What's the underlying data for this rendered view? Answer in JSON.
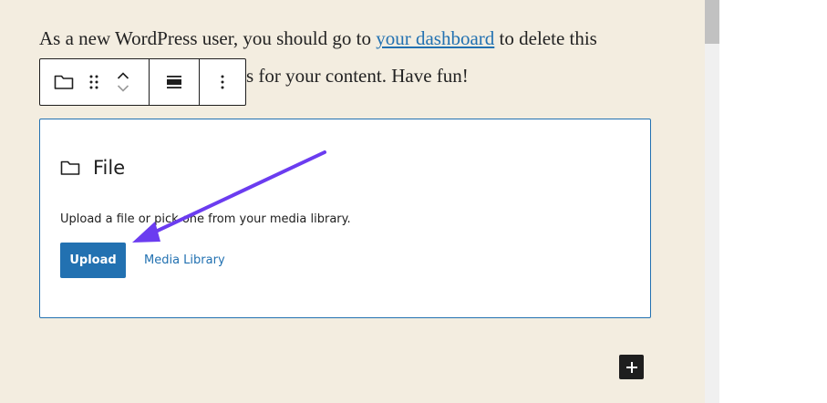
{
  "paragraph": {
    "before": "As a new WordPress user, you should go to ",
    "link": "your dashboard",
    "after": " to delete this",
    "line2": "s for your content. Have fun!"
  },
  "toolbar": {
    "icons": [
      "folder-icon",
      "drag-handle-icon",
      "move-up-icon",
      "move-down-icon",
      "align-icon",
      "more-options-icon"
    ]
  },
  "file_block": {
    "title": "File",
    "instructions": "Upload a file or pick one from your media library.",
    "upload_label": "Upload",
    "media_library_label": "Media Library"
  },
  "colors": {
    "accent": "#2271b1",
    "canvas": "#f3ede0",
    "annotation_arrow": "#6b3cf0"
  }
}
